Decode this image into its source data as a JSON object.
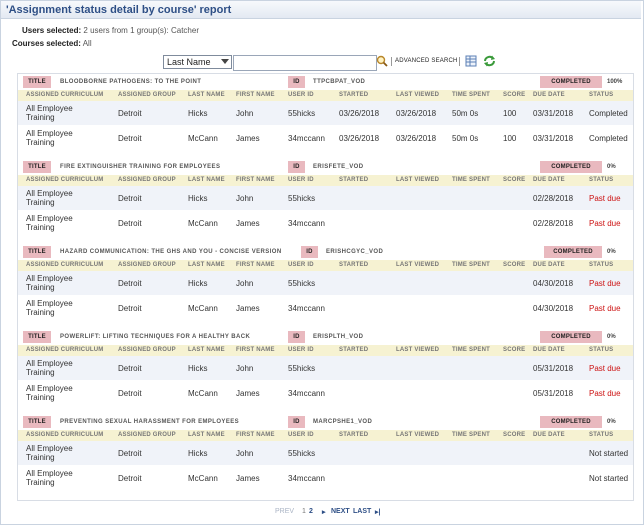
{
  "app": {
    "title": "'Assignment status detail by course' report"
  },
  "info": {
    "users_label": "Users selected:",
    "users_value": "2 users from 1 group(s): Catcher",
    "courses_label": "Courses selected:",
    "courses_value": "All"
  },
  "search": {
    "field_select": "Last Name",
    "query": "",
    "advanced_label": "ADVANCED SEARCH",
    "icons": [
      "magnifier-icon",
      "spreadsheet-export-icon",
      "refresh-icon"
    ]
  },
  "labels": {
    "title": "TITLE",
    "id": "ID"
  },
  "columns": [
    "ASSIGNED CURRICULUM",
    "ASSIGNED GROUP",
    "LAST NAME",
    "FIRST NAME",
    "USER ID",
    "STARTED",
    "LAST VIEWED",
    "TIME SPENT",
    "SCORE",
    "DUE DATE",
    "STATUS"
  ],
  "courses": [
    {
      "title": "BLOODBORNE PATHOGENS: TO THE POINT",
      "id": "TTPCBPAT_VOD",
      "completed_label": "COMPLETED",
      "completed_pct": "100%",
      "rows": [
        {
          "curriculum": "All Employee Training",
          "group": "Detroit",
          "last": "Hicks",
          "first": "John",
          "user_id": "55hicks",
          "started": "03/26/2018",
          "last_viewed": "03/26/2018",
          "time_spent": "50m 0s",
          "score": "100",
          "due": "03/31/2018",
          "status": "Completed",
          "status_color": "#333333"
        },
        {
          "curriculum": "All Employee Training",
          "group": "Detroit",
          "last": "McCann",
          "first": "James",
          "user_id": "34mccann",
          "started": "03/26/2018",
          "last_viewed": "03/26/2018",
          "time_spent": "50m 0s",
          "score": "100",
          "due": "03/31/2018",
          "status": "Completed",
          "status_color": "#333333"
        }
      ]
    },
    {
      "title": "FIRE EXTINGUISHER TRAINING FOR EMPLOYEES",
      "id": "ERISFETE_VOD",
      "completed_label": "COMPLETED",
      "completed_pct": "0%",
      "rows": [
        {
          "curriculum": "All Employee Training",
          "group": "Detroit",
          "last": "Hicks",
          "first": "John",
          "user_id": "55hicks",
          "started": "",
          "last_viewed": "",
          "time_spent": "",
          "score": "",
          "due": "02/28/2018",
          "status": "Past due",
          "status_color": "#cc1111"
        },
        {
          "curriculum": "All Employee Training",
          "group": "Detroit",
          "last": "McCann",
          "first": "James",
          "user_id": "34mccann",
          "started": "",
          "last_viewed": "",
          "time_spent": "",
          "score": "",
          "due": "02/28/2018",
          "status": "Past due",
          "status_color": "#cc1111"
        }
      ]
    },
    {
      "title": "HAZARD COMMUNICATION: THE GHS AND YOU - CONCISE VERSION",
      "id": "ERISHCGYC_VOD",
      "completed_label": "COMPLETED",
      "completed_pct": "0%",
      "rows": [
        {
          "curriculum": "All Employee Training",
          "group": "Detroit",
          "last": "Hicks",
          "first": "John",
          "user_id": "55hicks",
          "started": "",
          "last_viewed": "",
          "time_spent": "",
          "score": "",
          "due": "04/30/2018",
          "status": "Past due",
          "status_color": "#cc1111"
        },
        {
          "curriculum": "All Employee Training",
          "group": "Detroit",
          "last": "McCann",
          "first": "James",
          "user_id": "34mccann",
          "started": "",
          "last_viewed": "",
          "time_spent": "",
          "score": "",
          "due": "04/30/2018",
          "status": "Past due",
          "status_color": "#cc1111"
        }
      ]
    },
    {
      "title": "POWERLIFT: LIFTING TECHNIQUES FOR A HEALTHY BACK",
      "id": "ERISPLTH_VOD",
      "completed_label": "COMPLETED",
      "completed_pct": "0%",
      "rows": [
        {
          "curriculum": "All Employee Training",
          "group": "Detroit",
          "last": "Hicks",
          "first": "John",
          "user_id": "55hicks",
          "started": "",
          "last_viewed": "",
          "time_spent": "",
          "score": "",
          "due": "05/31/2018",
          "status": "Past due",
          "status_color": "#cc1111"
        },
        {
          "curriculum": "All Employee Training",
          "group": "Detroit",
          "last": "McCann",
          "first": "James",
          "user_id": "34mccann",
          "started": "",
          "last_viewed": "",
          "time_spent": "",
          "score": "",
          "due": "05/31/2018",
          "status": "Past due",
          "status_color": "#cc1111"
        }
      ]
    },
    {
      "title": "PREVENTING SEXUAL HARASSMENT FOR EMPLOYEES",
      "id": "MARCPSHE1_VOD",
      "completed_label": "COMPLETED",
      "completed_pct": "0%",
      "rows": [
        {
          "curriculum": "All Employee Training",
          "group": "Detroit",
          "last": "Hicks",
          "first": "John",
          "user_id": "55hicks",
          "started": "",
          "last_viewed": "",
          "time_spent": "",
          "score": "",
          "due": "",
          "status": "Not started",
          "status_color": "#333333"
        },
        {
          "curriculum": "All Employee Training",
          "group": "Detroit",
          "last": "McCann",
          "first": "James",
          "user_id": "34mccann",
          "started": "",
          "last_viewed": "",
          "time_spent": "",
          "score": "",
          "due": "",
          "status": "Not started",
          "status_color": "#333333"
        }
      ]
    }
  ],
  "pager": {
    "prev": "PREV",
    "page1": "1",
    "page2": "2",
    "next": "NEXT",
    "last": "LAST"
  },
  "colors": {
    "accent": "#2e4f86",
    "label_bg": "#e9b9bf",
    "header_bg": "#f6f2d2",
    "row_alt": "#f0f3f9",
    "past_due": "#cc1111"
  }
}
